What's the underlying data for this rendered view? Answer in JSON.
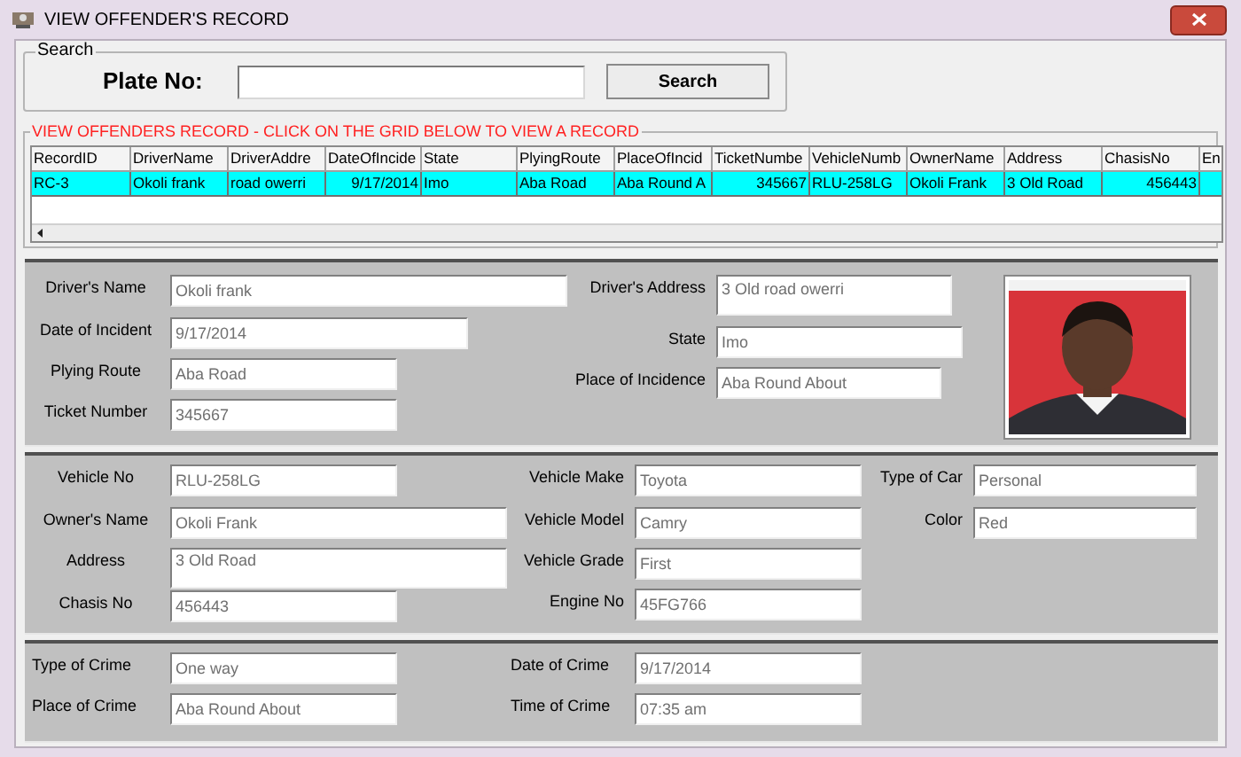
{
  "window": {
    "title": "VIEW OFFENDER'S RECORD"
  },
  "search": {
    "group_label": "Search",
    "label": "Plate No:",
    "button": "Search"
  },
  "grid": {
    "caption": "VIEW OFFENDERS RECORD - CLICK ON THE GRID BELOW TO VIEW A RECORD",
    "columns": [
      "RecordID",
      "DriverName",
      "DriverAddre",
      "DateOfIncide",
      "State",
      "PlyingRoute",
      "PlaceOfIncid",
      "TicketNumbe",
      "VehicleNumb",
      "OwnerName",
      "Address",
      "ChasisNo",
      "En"
    ],
    "rows": [
      {
        "selected": true,
        "cells": [
          "RC-3",
          "Okoli frank",
          "road owerri",
          "9/17/2014",
          "Imo",
          "Aba Road",
          "Aba Round A",
          "345667",
          "RLU-258LG",
          "Okoli Frank",
          "3 Old Road",
          "456443",
          ""
        ]
      }
    ]
  },
  "panels": [
    {
      "kind": "driver",
      "columns": [
        [
          {
            "label": "Driver's Name",
            "value": "Okoli frank"
          },
          {
            "label": "Date of Incident",
            "value": "9/17/2014"
          },
          {
            "label": "Plying Route",
            "value": "Aba Road"
          },
          {
            "label": "Ticket Number",
            "value": "345667"
          }
        ],
        [
          {
            "label": "Driver's Address",
            "value": "3 Old road owerri"
          },
          {
            "label": "State",
            "value": "Imo"
          },
          {
            "label": "Place of Incidence",
            "value": "Aba Round About"
          }
        ]
      ]
    },
    {
      "kind": "vehicle",
      "columns": [
        [
          {
            "label": "Vehicle No",
            "value": "RLU-258LG"
          },
          {
            "label": "Owner's Name",
            "value": "Okoli Frank"
          },
          {
            "label": "Address",
            "value": "3 Old Road"
          },
          {
            "label": "Chasis No",
            "value": "456443"
          }
        ],
        [
          {
            "label": "Vehicle Make",
            "value": "Toyota"
          },
          {
            "label": "Vehicle Model",
            "value": "Camry"
          },
          {
            "label": "Vehicle Grade",
            "value": "First"
          },
          {
            "label": "Engine No",
            "value": "45FG766"
          }
        ],
        [
          {
            "label": "Type of Car",
            "value": "Personal"
          },
          {
            "label": "Color",
            "value": "Red"
          }
        ]
      ]
    },
    {
      "kind": "crime",
      "columns": [
        [
          {
            "label": "Type of Crime",
            "value": "One way"
          },
          {
            "label": "Place of Crime",
            "value": "Aba Round About"
          }
        ],
        [
          {
            "label": "Date of Crime",
            "value": "9/17/2014"
          },
          {
            "label": "Time of Crime",
            "value": "07:35 am"
          }
        ]
      ]
    }
  ]
}
